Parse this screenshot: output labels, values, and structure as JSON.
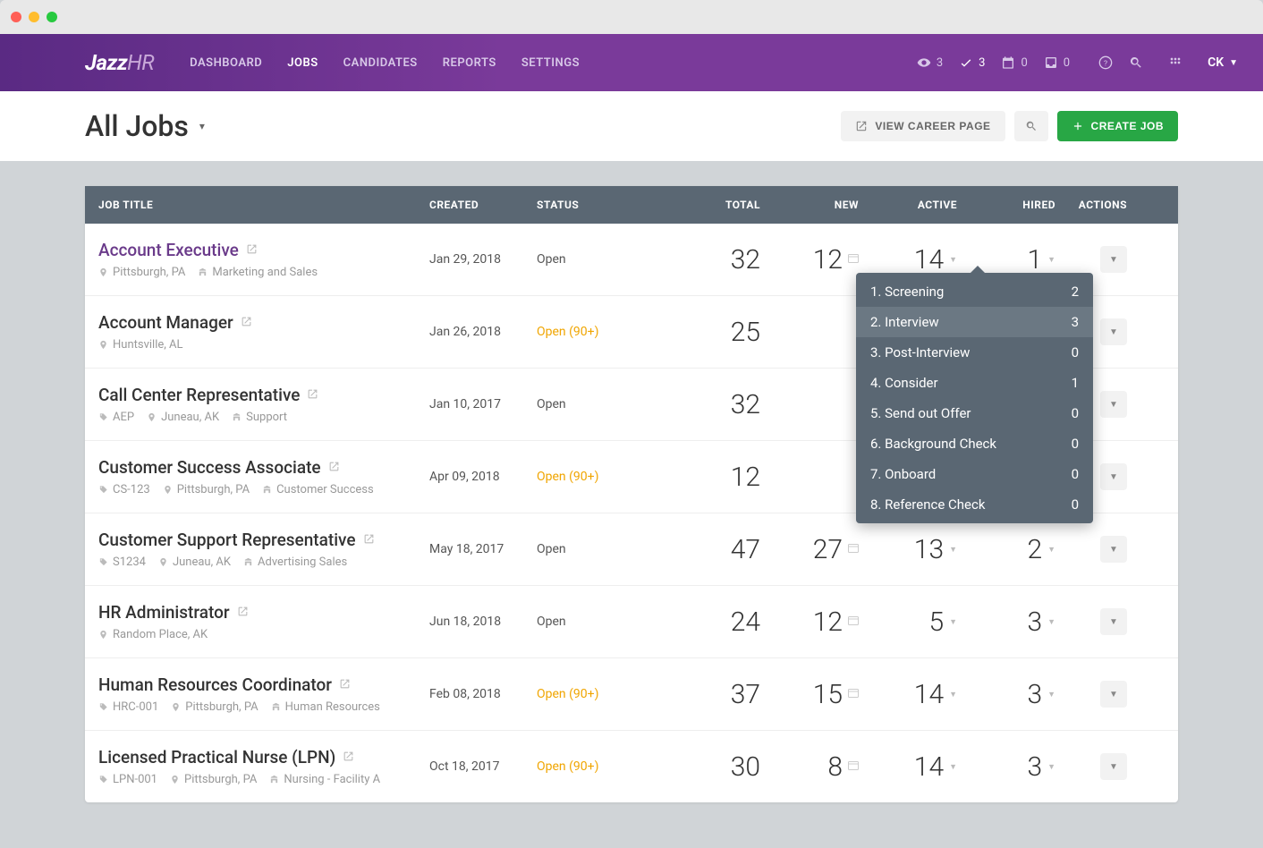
{
  "nav": {
    "items": [
      "DASHBOARD",
      "JOBS",
      "CANDIDATES",
      "REPORTS",
      "SETTINGS"
    ],
    "active_index": 1
  },
  "top_counts": {
    "eye": "3",
    "check": "3",
    "calendar": "0",
    "inbox": "0"
  },
  "user": "CK",
  "page_title": "All Jobs",
  "buttons": {
    "view_career": "VIEW CAREER PAGE",
    "create_job": "CREATE JOB"
  },
  "columns": [
    "JOB TITLE",
    "CREATED",
    "STATUS",
    "TOTAL",
    "NEW",
    "ACTIVE",
    "HIRED",
    "ACTIONS"
  ],
  "jobs": [
    {
      "title": "Account Executive",
      "title_linked": true,
      "meta": [
        {
          "icon": "pin",
          "text": "Pittsburgh, PA"
        },
        {
          "icon": "org",
          "text": "Marketing and Sales"
        }
      ],
      "created": "Jan 29, 2018",
      "status": "Open",
      "status_warn": false,
      "total": "32",
      "new": "12",
      "new_card": true,
      "active": "14",
      "active_caret": true,
      "hired": "1",
      "hired_caret": true
    },
    {
      "title": "Account Manager",
      "meta": [
        {
          "icon": "pin",
          "text": "Huntsville, AL"
        }
      ],
      "created": "Jan 26, 2018",
      "status": "Open (90+)",
      "status_warn": true,
      "total": "25",
      "new": "",
      "active": "",
      "hired": ""
    },
    {
      "title": "Call Center Representative",
      "meta": [
        {
          "icon": "tag",
          "text": "AEP"
        },
        {
          "icon": "pin",
          "text": "Juneau, AK"
        },
        {
          "icon": "org",
          "text": "Support"
        }
      ],
      "created": "Jan 10, 2017",
      "status": "Open",
      "status_warn": false,
      "total": "32",
      "new": "",
      "active": "",
      "hired": ""
    },
    {
      "title": "Customer Success Associate",
      "meta": [
        {
          "icon": "tag",
          "text": "CS-123"
        },
        {
          "icon": "pin",
          "text": "Pittsburgh, PA"
        },
        {
          "icon": "org",
          "text": "Customer Success"
        }
      ],
      "created": "Apr 09, 2018",
      "status": "Open (90+)",
      "status_warn": true,
      "total": "12",
      "new": "",
      "active": "",
      "hired": ""
    },
    {
      "title": "Customer Support Representative",
      "meta": [
        {
          "icon": "tag",
          "text": "S1234"
        },
        {
          "icon": "pin",
          "text": "Juneau, AK"
        },
        {
          "icon": "org",
          "text": "Advertising Sales"
        }
      ],
      "created": "May 18, 2017",
      "status": "Open",
      "status_warn": false,
      "total": "47",
      "new": "27",
      "new_card": true,
      "active": "13",
      "active_caret": true,
      "hired": "2",
      "hired_caret": true
    },
    {
      "title": "HR Administrator",
      "meta": [
        {
          "icon": "pin",
          "text": "Random Place, AK"
        }
      ],
      "created": "Jun 18, 2018",
      "status": "Open",
      "status_warn": false,
      "total": "24",
      "new": "12",
      "new_card": true,
      "active": "5",
      "active_caret": true,
      "hired": "3",
      "hired_caret": true
    },
    {
      "title": "Human Resources Coordinator",
      "meta": [
        {
          "icon": "tag",
          "text": "HRC-001"
        },
        {
          "icon": "pin",
          "text": "Pittsburgh, PA"
        },
        {
          "icon": "org",
          "text": "Human Resources"
        }
      ],
      "created": "Feb 08, 2018",
      "status": "Open (90+)",
      "status_warn": true,
      "total": "37",
      "new": "15",
      "new_card": true,
      "active": "14",
      "active_caret": true,
      "hired": "3",
      "hired_caret": true
    },
    {
      "title": "Licensed Practical Nurse (LPN)",
      "meta": [
        {
          "icon": "tag",
          "text": "LPN-001"
        },
        {
          "icon": "pin",
          "text": "Pittsburgh, PA"
        },
        {
          "icon": "org",
          "text": "Nursing - Facility A"
        }
      ],
      "created": "Oct 18, 2017",
      "status": "Open (90+)",
      "status_warn": true,
      "total": "30",
      "new": "8",
      "new_card": true,
      "active": "14",
      "active_caret": true,
      "hired": "3",
      "hired_caret": true
    }
  ],
  "popover": {
    "row_index": 0,
    "items": [
      {
        "label": "1. Screening",
        "count": "2"
      },
      {
        "label": "2. Interview",
        "count": "3",
        "hover": true
      },
      {
        "label": "3. Post-Interview",
        "count": "0"
      },
      {
        "label": "4. Consider",
        "count": "1"
      },
      {
        "label": "5. Send out Offer",
        "count": "0"
      },
      {
        "label": "6. Background Check",
        "count": "0"
      },
      {
        "label": "7. Onboard",
        "count": "0"
      },
      {
        "label": "8. Reference Check",
        "count": "0"
      }
    ]
  }
}
